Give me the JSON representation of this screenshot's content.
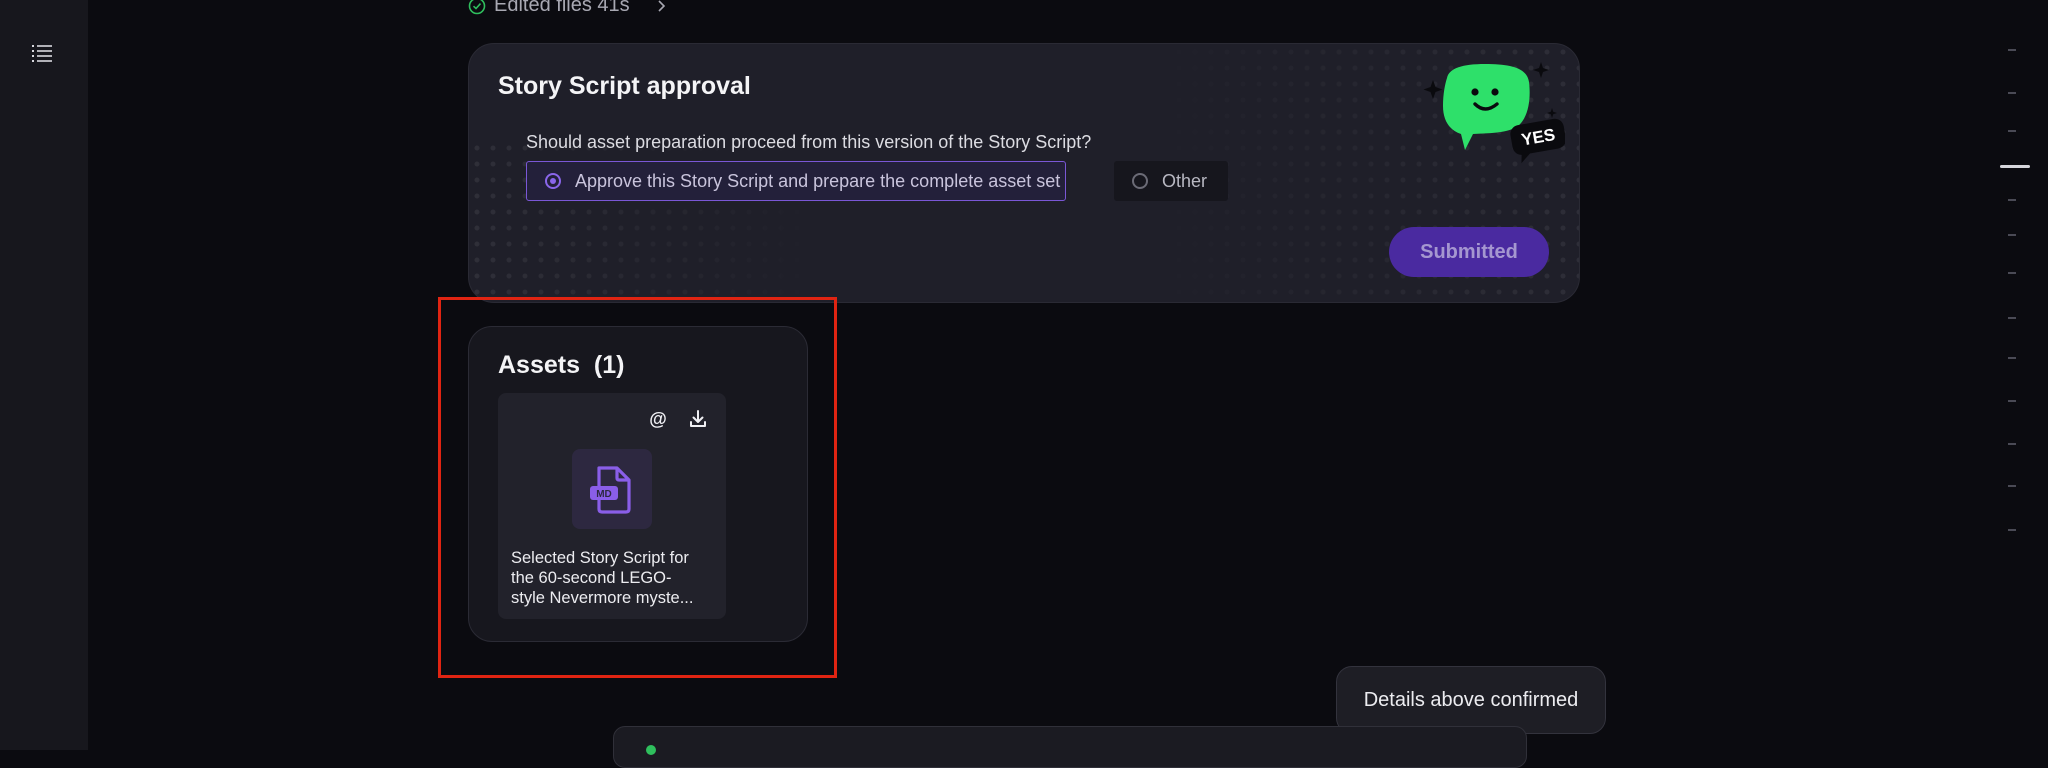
{
  "sidebar": {
    "toc_icon": "list-icon"
  },
  "activity": {
    "edited_label": "Edited files 41s",
    "status_color": "#2fbf5d"
  },
  "approval": {
    "title": "Story Script approval",
    "question": "Should asset preparation proceed from this version of the Story Script?",
    "options": [
      {
        "label": "Approve this Story Script and prepare the complete asset set",
        "selected": true
      },
      {
        "label": "Other",
        "selected": false
      }
    ],
    "submit_label": "Submitted",
    "mascot_text": "YES",
    "accent_color": "#7a57d6"
  },
  "assets": {
    "title": "Assets",
    "count": "(1)",
    "items": [
      {
        "file_type": "MD",
        "caption_lines": [
          "Selected Story Script for",
          "the 60-second LEGO-",
          "style Nevermore myste..."
        ],
        "actions": [
          "at-icon",
          "download-icon"
        ]
      }
    ]
  },
  "confirmation": {
    "label": "Details above confirmed"
  }
}
